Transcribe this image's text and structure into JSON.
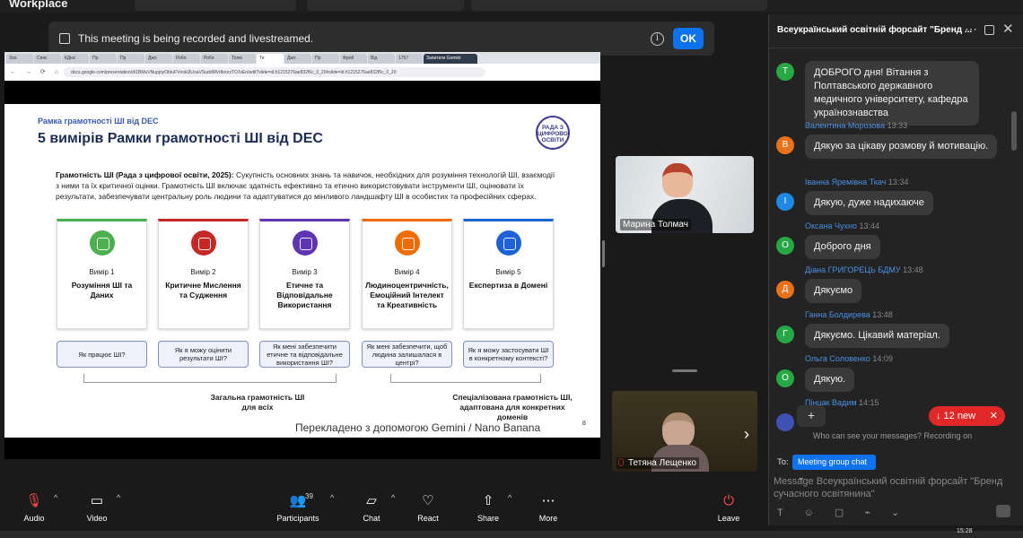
{
  "os": {
    "app_name": "Workplace",
    "clock": "15:28"
  },
  "banner": {
    "text": "This meeting is being recorded and livestreamed.",
    "ok_label": "OK"
  },
  "browser": {
    "tabs": [
      "Зоо",
      "Спис",
      "КДюс",
      "Пр",
      "Пр",
      "Джо",
      "Робо",
      "Робо",
      "Толм",
      "Те",
      "Джо",
      "Пр",
      "Фрей",
      "Від",
      "1757",
      "Запитати Gemini"
    ],
    "url": "docs.google.com/presentation/d/1BMuVNupjoyObIuFVnoki3UoaVSuddMVr8oorzTOJvEo/edit?slide=id.h1215276ae832f6c_0_20#slide=id.h1215276ae832f6c_0_20",
    "nav_glyphs": "← → ⟳ ⌂"
  },
  "slide": {
    "overline": "Рамка грамотності ШІ від DEC",
    "title": "5 вимірів Рамки грамотності ШІ від DEC",
    "logo_text": [
      "РАДА З",
      "ЦИФРОВОЇ",
      "ОСВІТИ"
    ],
    "definition_bold": "Грамотність ШІ (Рада з цифрової освіти, 2025):",
    "definition_rest": " Сукупність основних знань та навичок, необхідних для розуміння технологій ШІ, взаємодії з ними та їх критичної оцінки. Грамотність ШІ включає здатність ефективно та етично використовувати інструменти ШІ, оцінювати їх результати, забезпечувати центральну роль людини та адаптуватися до мінливого ландшафту ШІ в особистих та професійних сферах.",
    "cards": [
      {
        "num": "Вимір 1",
        "name": "Розуміння ШІ та Даних",
        "color": "#4caf50"
      },
      {
        "num": "Вимір 2",
        "name": "Критичне Мислення та Судження",
        "color": "#c62828"
      },
      {
        "num": "Вимір 3",
        "name": "Етичне та Відповідальне Використання",
        "color": "#5e35b1"
      },
      {
        "num": "Вимір 4",
        "name": "Людиноцентричність, Емоційний Інтелект та Креативність",
        "color": "#ef6c00"
      },
      {
        "num": "Вимір 5",
        "name": "Експертиза в Домені",
        "color": "#1e63d6"
      }
    ],
    "questions": [
      "Як працює ШІ?",
      "Як я можу оцінити результати ШІ?",
      "Як мені забезпечити етичне та відповідальне використання ШІ?",
      "Як мені забезпечити, щоб людина залишалася в центрі?",
      "Як я можу застосувати ШІ в конкретному контексті?"
    ],
    "footer_left": "Загальна грамотність ШІ для всіх",
    "footer_right": "Спеціалізована грамотність ШІ, адаптована для конкретних доменів",
    "translated": "Перекладено з допомогою Gemini / Nano Banana",
    "page_number": "8"
  },
  "videos": {
    "top": "Марина Толмач",
    "bottom": "Тетяна Лещенко"
  },
  "chat": {
    "title": "Всеукраїнський освітній форсайт \"Бренд ...",
    "messages": [
      {
        "sender": "",
        "time": "",
        "initial": "Т",
        "color": "#27a844",
        "text": "ДОБРОГО дня! Вітання з Полтавського державного медичного університету, кафедра українознавства"
      },
      {
        "sender": "Валентина Морозова",
        "time": "13:33",
        "initial": "В",
        "color": "#e8711a",
        "text": "Дякую за цікаву розмову й мотивацію."
      },
      {
        "sender": "Іванна Яремівна Ткач",
        "time": "13:34",
        "initial": "І",
        "color": "#1e88e5",
        "text": "Дякую, дуже надихаюче"
      },
      {
        "sender": "Оксана Чухно",
        "time": "13:44",
        "initial": "О",
        "color": "#27a844",
        "text": "Доброго дня"
      },
      {
        "sender": "Діана ГРИГОРЕЦЬ БДМУ",
        "time": "13:48",
        "initial": "Д",
        "color": "#e8711a",
        "text": "Дякуємо"
      },
      {
        "sender": "Ганна Болдирева",
        "time": "13:48",
        "initial": "Г",
        "color": "#27a844",
        "text": "Дякуємо. Цікавий матеріал."
      },
      {
        "sender": "Ольга Соловенко",
        "time": "14:09",
        "initial": "О",
        "color": "#27a844",
        "text": "Дякую."
      },
      {
        "sender": "Пінцак Вадим",
        "time": "14:15",
        "initial": "",
        "color": "#3f51b5",
        "text": ""
      }
    ],
    "plus_label": "+",
    "new_badge": "↓  12 new",
    "new_close": "✕",
    "who_can_see": "Who can see your messages? Recording on",
    "to_label": "To:",
    "to_value": "Meeting group chat ⌄",
    "compose_placeholder": "Message Всеукраїнський освітній форсайт \"Бренд сучасного освітянина\"",
    "format_glyphs": "T ☺ ▢ ⌁ ⌄"
  },
  "toolbar": {
    "audio": "Audio",
    "video": "Video",
    "participants": "Participants",
    "participants_count": "39",
    "chat": "Chat",
    "react": "React",
    "share": "Share",
    "more": "More",
    "leave": "Leave"
  }
}
